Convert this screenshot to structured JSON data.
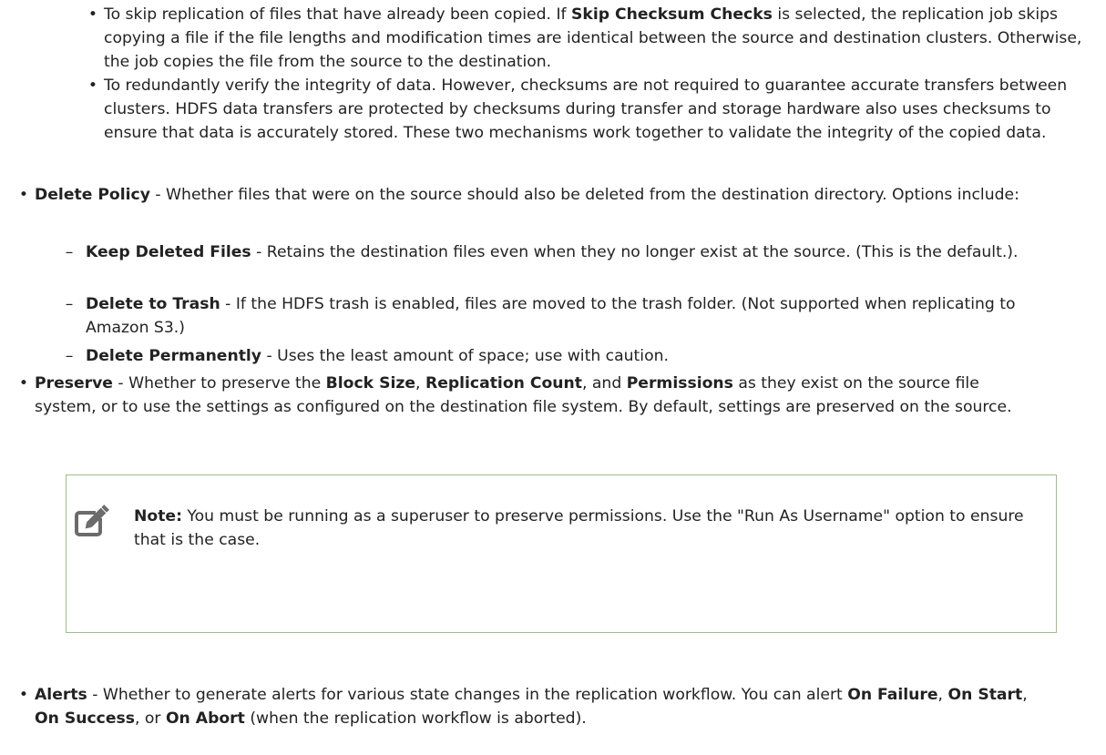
{
  "sub_bullets": [
    {
      "marker": "•",
      "parts": [
        {
          "t": "To skip replication of files that have already been copied. If ",
          "b": false
        },
        {
          "t": "Skip Checksum Checks",
          "b": true
        },
        {
          "t": " is selected, the replication job skips copying a file if the file lengths and modification times are identical between the source and destination clusters. Otherwise, the job copies the file from the source to the destination.",
          "b": false
        }
      ]
    },
    {
      "marker": "•",
      "parts": [
        {
          "t": "To redundantly verify the integrity of data. However, checksums are not required to guarantee accurate transfers between clusters. HDFS data transfers are protected by checksums during transfer and storage hardware also uses checksums to ensure that data is accurately stored. These two mechanisms work together to validate the integrity of the copied data.",
          "b": false
        }
      ]
    }
  ],
  "delete_policy": {
    "marker": "•",
    "parts": [
      {
        "t": "Delete Policy",
        "b": true
      },
      {
        "t": " - Whether files that were on the source should also be deleted from the destination directory. Options include:",
        "b": false
      }
    ],
    "options": [
      {
        "marker": "–",
        "parts": [
          {
            "t": "Keep Deleted Files",
            "b": true
          },
          {
            "t": " - Retains the destination files even when they no longer exist at the source. (This is the default.).",
            "b": false
          }
        ]
      },
      {
        "marker": "–",
        "parts": [
          {
            "t": "Delete to Trash",
            "b": true
          },
          {
            "t": " - If the HDFS trash is enabled, files are moved to the trash folder. (Not supported when replicating to Amazon S3.)",
            "b": false
          }
        ]
      },
      {
        "marker": "–",
        "parts": [
          {
            "t": "Delete Permanently",
            "b": true
          },
          {
            "t": " - Uses the least amount of space; use with caution.",
            "b": false
          }
        ]
      }
    ]
  },
  "preserve": {
    "marker": "•",
    "parts": [
      {
        "t": "Preserve",
        "b": true
      },
      {
        "t": " - Whether to preserve the ",
        "b": false
      },
      {
        "t": "Block Size",
        "b": true
      },
      {
        "t": ", ",
        "b": false
      },
      {
        "t": "Replication Count",
        "b": true
      },
      {
        "t": ", and ",
        "b": false
      },
      {
        "t": "Permissions",
        "b": true
      },
      {
        "t": "  as they exist on the source file system, or to use the settings as configured on the destination file system. By default, settings are preserved on the source.",
        "b": false
      }
    ]
  },
  "note": {
    "icon": "note-edit-icon",
    "border_color": "#9bbf8a",
    "parts": [
      {
        "t": "Note:",
        "b": true
      },
      {
        "t": "  You must be running as a superuser to preserve permissions. Use the \"Run As Username\" option to ensure that is the case.",
        "b": false
      }
    ]
  },
  "alerts": {
    "marker": "•",
    "parts": [
      {
        "t": "Alerts",
        "b": true
      },
      {
        "t": " - Whether to generate alerts for various state changes in the replication workflow. You can alert ",
        "b": false
      },
      {
        "t": "On Failure",
        "b": true
      },
      {
        "t": ", ",
        "b": false
      },
      {
        "t": "On Start",
        "b": true
      },
      {
        "t": ", ",
        "b": false
      },
      {
        "t": "On Success",
        "b": true
      },
      {
        "t": ", or ",
        "b": false
      },
      {
        "t": "On Abort",
        "b": true
      },
      {
        "t": " (when the replication workflow is aborted).",
        "b": false
      }
    ]
  }
}
